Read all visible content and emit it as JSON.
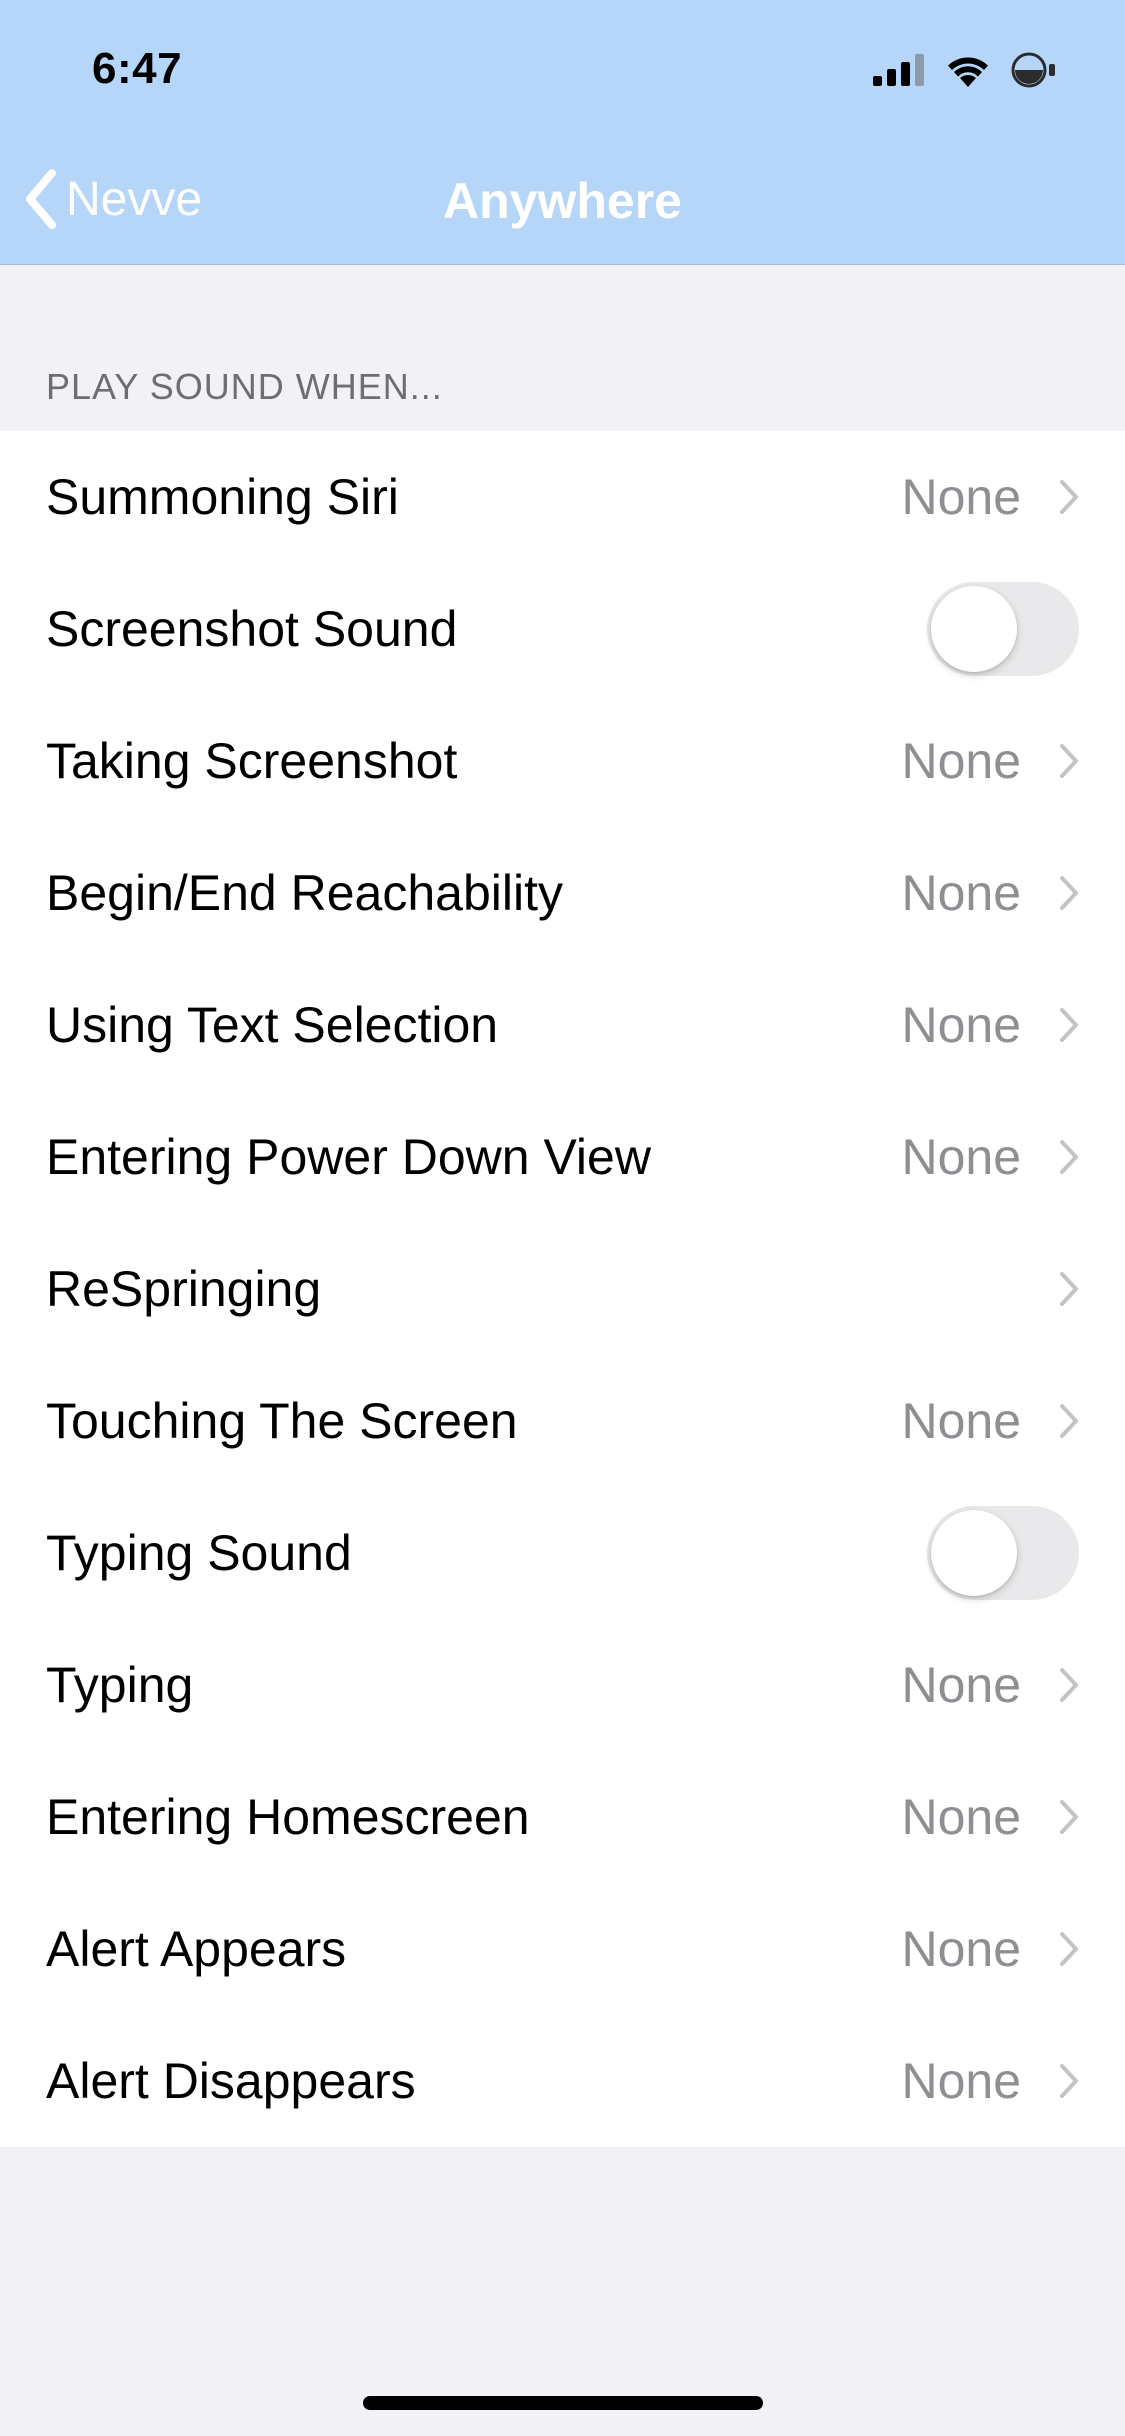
{
  "status_bar": {
    "time": "6:47"
  },
  "nav": {
    "back_label": "Nevve",
    "title": "Anywhere"
  },
  "section": {
    "header": "PLAY SOUND WHEN..."
  },
  "rows": [
    {
      "label": "Summoning Siri",
      "value": "None"
    },
    {
      "label": "Screenshot Sound",
      "toggle": false
    },
    {
      "label": "Taking Screenshot",
      "value": "None"
    },
    {
      "label": "Begin/End Reachability",
      "value": "None"
    },
    {
      "label": "Using Text Selection",
      "value": "None"
    },
    {
      "label": "Entering Power Down View",
      "value": "None"
    },
    {
      "label": "ReSpringing",
      "value": ""
    },
    {
      "label": "Touching The Screen",
      "value": "None"
    },
    {
      "label": "Typing Sound",
      "toggle": false
    },
    {
      "label": "Typing",
      "value": "None"
    },
    {
      "label": "Entering Homescreen",
      "value": "None"
    },
    {
      "label": "Alert Appears",
      "value": "None"
    },
    {
      "label": "Alert Disappears",
      "value": "None"
    }
  ],
  "colors": {
    "nav_background": "#b5d6f8",
    "page_background": "#f2f1f6",
    "secondary_text": "#8e8e93",
    "toggle_off": "#e9e9eb"
  }
}
